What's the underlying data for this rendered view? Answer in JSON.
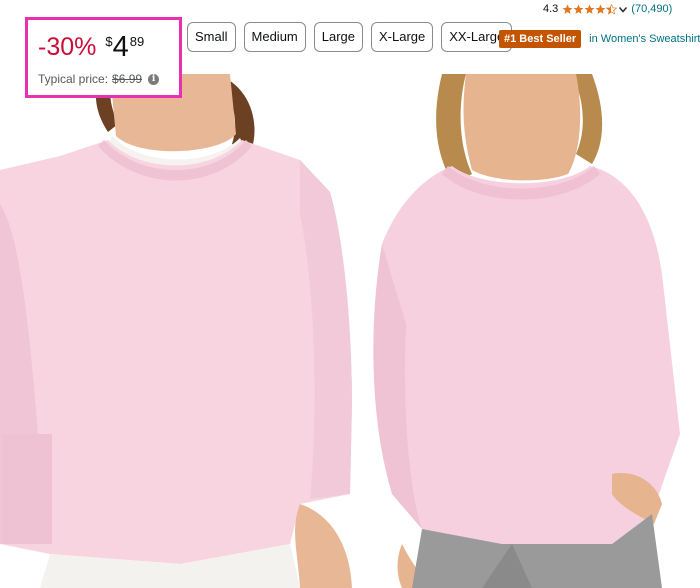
{
  "price_box": {
    "discount": "-30%",
    "currency": "$",
    "price_whole": "4",
    "price_fraction": "89",
    "typical_label": "Typical price:",
    "typical_value": "$6.99",
    "info_icon": "info-icon"
  },
  "sizes": [
    "Small",
    "Medium",
    "Large",
    "X-Large",
    "XX-Large"
  ],
  "rating": {
    "value": "4.3",
    "stars": 4.3,
    "count": "(70,490)",
    "chevron_icon": "chevron-down-icon"
  },
  "best_seller": {
    "badge": "#1 Best Seller",
    "category": "in Women's Sweatshirts"
  },
  "colors": {
    "highlight": "#e830b0",
    "discount": "#cc0c39",
    "badge": "#c45500",
    "link": "#007185",
    "star": "#de7921",
    "sweatshirt": "#f7d3df"
  }
}
